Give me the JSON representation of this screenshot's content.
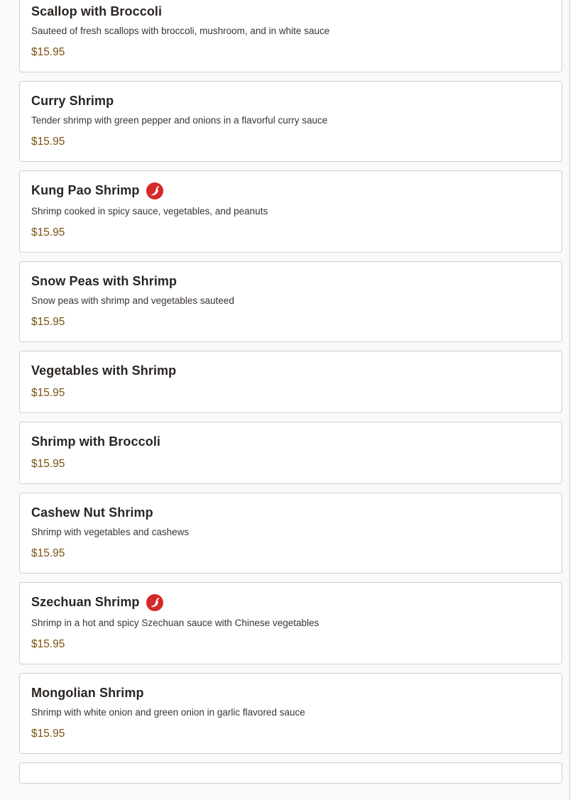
{
  "menu": {
    "items": [
      {
        "name": "Scallop with Broccoli",
        "description": "Sauteed of fresh scallops with broccoli, mushroom, and in white sauce",
        "price": "$15.95",
        "spicy": false
      },
      {
        "name": "Curry Shrimp",
        "description": "Tender shrimp with green pepper and onions in a flavorful curry sauce",
        "price": "$15.95",
        "spicy": false
      },
      {
        "name": "Kung Pao Shrimp",
        "description": "Shrimp cooked in spicy sauce, vegetables, and peanuts",
        "price": "$15.95",
        "spicy": true
      },
      {
        "name": "Snow Peas with Shrimp",
        "description": "Snow peas with shrimp and vegetables sauteed",
        "price": "$15.95",
        "spicy": false
      },
      {
        "name": "Vegetables with Shrimp",
        "description": "",
        "price": "$15.95",
        "spicy": false
      },
      {
        "name": "Shrimp with Broccoli",
        "description": "",
        "price": "$15.95",
        "spicy": false
      },
      {
        "name": "Cashew Nut Shrimp",
        "description": "Shrimp with vegetables and cashews",
        "price": "$15.95",
        "spicy": false
      },
      {
        "name": "Szechuan Shrimp",
        "description": "Shrimp in a hot and spicy Szechuan sauce with Chinese vegetables",
        "price": "$15.95",
        "spicy": true
      },
      {
        "name": "Mongolian Shrimp",
        "description": "Shrimp with white onion and green onion in garlic flavored sauce",
        "price": "$15.95",
        "spicy": false
      }
    ],
    "icons": {
      "spicy": "chili-pepper-icon"
    },
    "colors": {
      "price": "#7a5212",
      "spicy_icon": "#d42a2a",
      "card_border": "#d4d0cb",
      "title": "#2a2522"
    }
  }
}
